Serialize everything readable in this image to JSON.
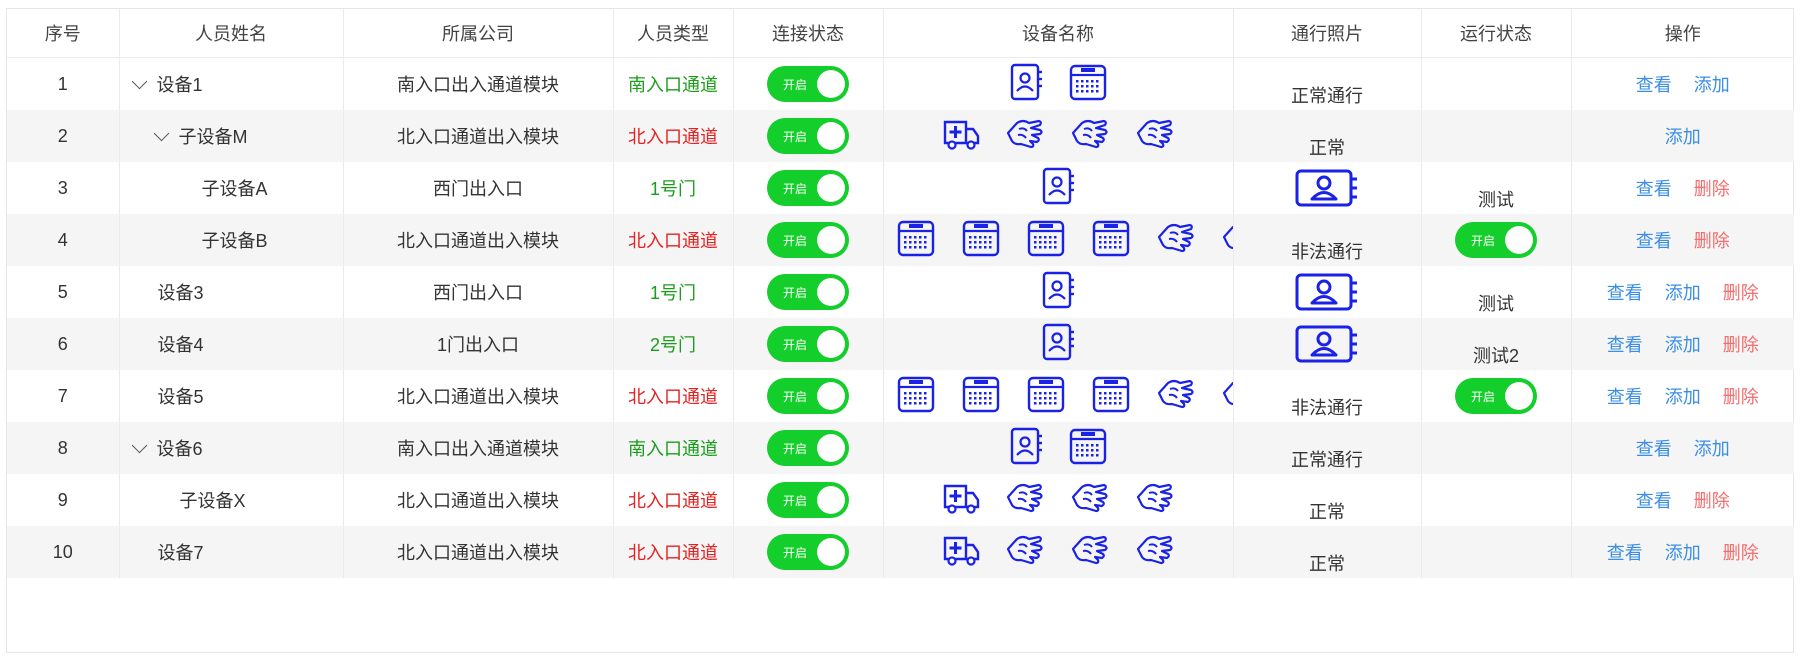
{
  "columns": [
    "序号",
    "人员姓名",
    "所属公司",
    "人员类型",
    "连接状态",
    "设备名称",
    "通行照片",
    "运行状态",
    "操作"
  ],
  "colors": {
    "green": "#1a9d1a",
    "red": "#e52222",
    "toggle": "#13ce2b",
    "link": "#3a8ee6",
    "delete": "#f56c6c",
    "icon": "#1a22e6"
  },
  "toggle_label": "开启",
  "ops_labels": {
    "view": "查看",
    "add": "添加",
    "delete": "删除"
  },
  "rows": [
    {
      "no": "1",
      "name": "设备1",
      "indent": 0,
      "expand": true,
      "company": "南入口出入通道模块",
      "type": "南入口通道",
      "type_color": "green",
      "devices": [
        "contact-book",
        "cardreader"
      ],
      "devices_overflow": false,
      "photo": "",
      "pass": "正常通行",
      "status_toggle": false,
      "status": "",
      "ops": [
        "view",
        "add"
      ]
    },
    {
      "no": "2",
      "name": "子设备M",
      "indent": 1,
      "expand": true,
      "company": "北入口通道出入模块",
      "type": "北入口通道",
      "type_color": "red",
      "devices": [
        "ambulance",
        "hand",
        "hand",
        "hand"
      ],
      "devices_overflow": false,
      "photo": "",
      "pass": "正常",
      "status_toggle": false,
      "status": "",
      "ops": [
        "add"
      ]
    },
    {
      "no": "3",
      "name": "子设备A",
      "indent": 2,
      "expand": false,
      "company": "西门出入口",
      "type": "1号门",
      "type_color": "green",
      "devices": [
        "contact-book"
      ],
      "devices_overflow": false,
      "photo": "contact-card",
      "pass": "",
      "status_toggle": false,
      "status": "测试",
      "ops": [
        "view",
        "delete"
      ]
    },
    {
      "no": "4",
      "name": "子设备B",
      "indent": 2,
      "expand": false,
      "company": "北入口通道出入模块",
      "type": "北入口通道",
      "type_color": "red",
      "devices": [
        "cardreader",
        "cardreader",
        "cardreader",
        "cardreader",
        "hand",
        "hand"
      ],
      "devices_overflow": true,
      "photo": "",
      "pass": "非法通行",
      "status_toggle": true,
      "status": "",
      "ops": [
        "view",
        "delete"
      ]
    },
    {
      "no": "5",
      "name": "设备3",
      "indent": 0,
      "expand": false,
      "company": "西门出入口",
      "type": "1号门",
      "type_color": "green",
      "devices": [
        "contact-book"
      ],
      "devices_overflow": false,
      "photo": "contact-card",
      "pass": "",
      "status_toggle": false,
      "status": "测试",
      "ops": [
        "view",
        "add",
        "delete"
      ]
    },
    {
      "no": "6",
      "name": "设备4",
      "indent": 0,
      "expand": false,
      "company": "1门出入口",
      "type": "2号门",
      "type_color": "green",
      "devices": [
        "contact-book"
      ],
      "devices_overflow": false,
      "photo": "contact-card",
      "pass": "",
      "status_toggle": false,
      "status": "测试2",
      "ops": [
        "view",
        "add",
        "delete"
      ]
    },
    {
      "no": "7",
      "name": "设备5",
      "indent": 0,
      "expand": false,
      "company": "北入口通道出入模块",
      "type": "北入口通道",
      "type_color": "red",
      "devices": [
        "cardreader",
        "cardreader",
        "cardreader",
        "cardreader",
        "hand",
        "hand"
      ],
      "devices_overflow": true,
      "photo": "",
      "pass": "非法通行",
      "status_toggle": true,
      "status": "",
      "ops": [
        "view",
        "add",
        "delete"
      ]
    },
    {
      "no": "8",
      "name": "设备6",
      "indent": 0,
      "expand": true,
      "company": "南入口出入通道模块",
      "type": "南入口通道",
      "type_color": "green",
      "devices": [
        "contact-book",
        "cardreader"
      ],
      "devices_overflow": false,
      "photo": "",
      "pass": "正常通行",
      "status_toggle": false,
      "status": "",
      "ops": [
        "view",
        "add"
      ]
    },
    {
      "no": "9",
      "name": "子设备X",
      "indent": 1,
      "expand": false,
      "company": "北入口通道出入模块",
      "type": "北入口通道",
      "type_color": "red",
      "devices": [
        "ambulance",
        "hand",
        "hand",
        "hand"
      ],
      "devices_overflow": false,
      "photo": "",
      "pass": "正常",
      "status_toggle": false,
      "status": "",
      "ops": [
        "view",
        "delete"
      ]
    },
    {
      "no": "10",
      "name": "设备7",
      "indent": 0,
      "expand": false,
      "company": "北入口通道出入模块",
      "type": "北入口通道",
      "type_color": "red",
      "devices": [
        "ambulance",
        "hand",
        "hand",
        "hand"
      ],
      "devices_overflow": false,
      "photo": "",
      "pass": "正常",
      "status_toggle": false,
      "status": "",
      "ops": [
        "view",
        "add",
        "delete"
      ]
    }
  ]
}
